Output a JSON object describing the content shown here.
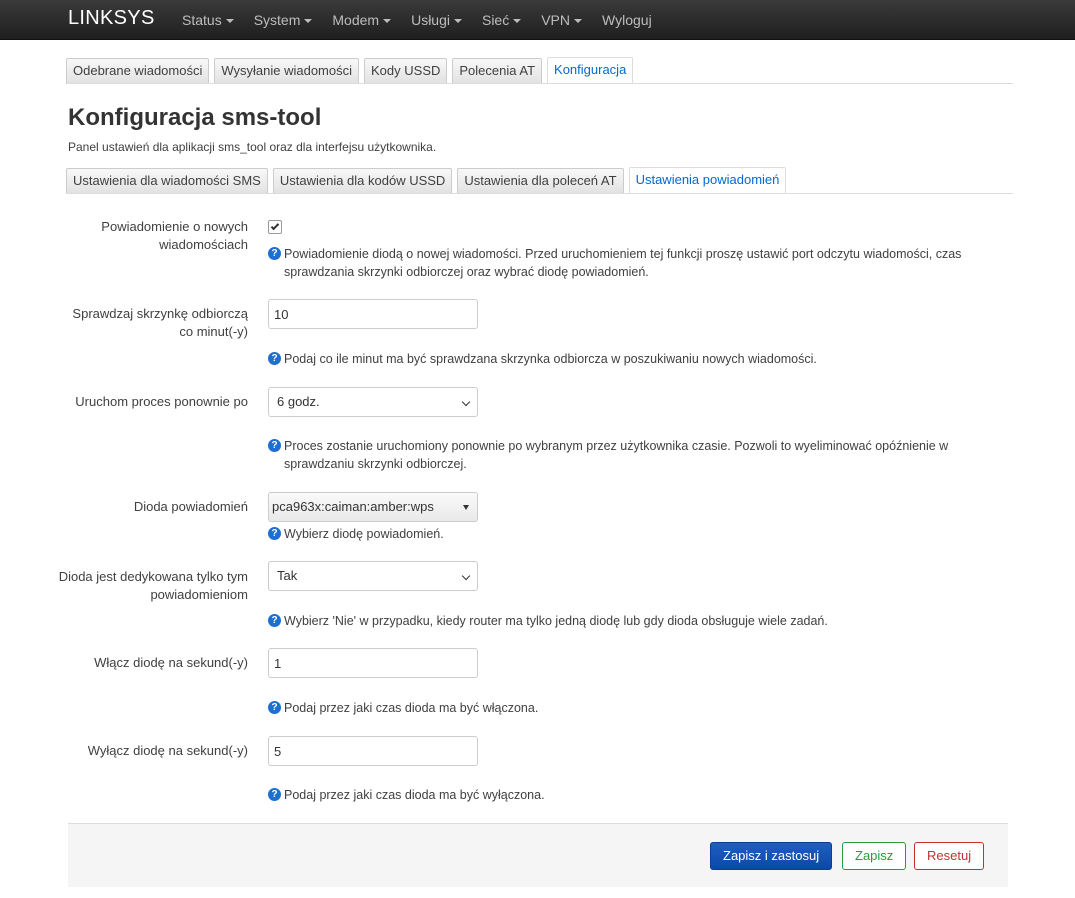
{
  "navbar": {
    "brand": "LINKSYS",
    "items": [
      {
        "label": "Status"
      },
      {
        "label": "System"
      },
      {
        "label": "Modem"
      },
      {
        "label": "Usługi"
      },
      {
        "label": "Sieć"
      },
      {
        "label": "VPN"
      },
      {
        "label": "Wyloguj"
      }
    ]
  },
  "main_tabs": [
    {
      "label": "Odebrane wiadomości"
    },
    {
      "label": "Wysyłanie wiadomości"
    },
    {
      "label": "Kody USSD"
    },
    {
      "label": "Polecenia AT"
    },
    {
      "label": "Konfiguracja"
    }
  ],
  "page": {
    "title": "Konfiguracja sms-tool",
    "description": "Panel ustawień dla aplikacji sms_tool oraz dla interfejsu użytkownika."
  },
  "sub_tabs": [
    {
      "label": "Ustawienia dla wiadomości SMS"
    },
    {
      "label": "Ustawienia dla kodów USSD"
    },
    {
      "label": "Ustawienia dla poleceń AT"
    },
    {
      "label": "Ustawienia powiadomień"
    }
  ],
  "form": {
    "notify_new": {
      "label": "Powiadomienie o nowych wiadomościach",
      "checked": true,
      "help": "Powiadomienie diodą o nowej wiadomości. Przed uruchomieniem tej funkcji proszę ustawić port odczytu wiadomości, czas sprawdzania skrzynki odbiorczej oraz wybrać diodę powiadomień."
    },
    "check_inbox": {
      "label": "Sprawdzaj skrzynkę odbiorczą co minut(-y)",
      "value": "10",
      "help": "Podaj co ile minut ma być sprawdzana skrzynka odbiorcza w poszukiwaniu nowych wiadomości."
    },
    "restart_after": {
      "label": "Uruchom proces ponownie po",
      "value": "6 godz.",
      "help": "Proces zostanie uruchomiony ponownie po wybranym przez użytkownika czasie. Pozwoli to wyeliminować opóźnienie w sprawdzaniu skrzynki odbiorczej."
    },
    "led": {
      "label": "Dioda powiadomień",
      "value": "pca963x:caiman:amber:wps",
      "help": "Wybierz diodę powiadomień."
    },
    "led_dedicated": {
      "label": "Dioda jest dedykowana tylko tym powiadomieniom",
      "value": "Tak",
      "help": "Wybierz 'Nie' w przypadku, kiedy router ma tylko jedną diodę lub gdy dioda obsługuje wiele zadań."
    },
    "led_on": {
      "label": "Włącz diodę na sekund(-y)",
      "value": "1",
      "help": "Podaj przez jaki czas dioda ma być włączona."
    },
    "led_off": {
      "label": "Wyłącz diodę na sekund(-y)",
      "value": "5",
      "help": "Podaj przez jaki czas dioda ma być wyłączona."
    }
  },
  "buttons": {
    "save_apply": "Zapisz i zastosuj",
    "save": "Zapisz",
    "reset": "Resetuj"
  }
}
